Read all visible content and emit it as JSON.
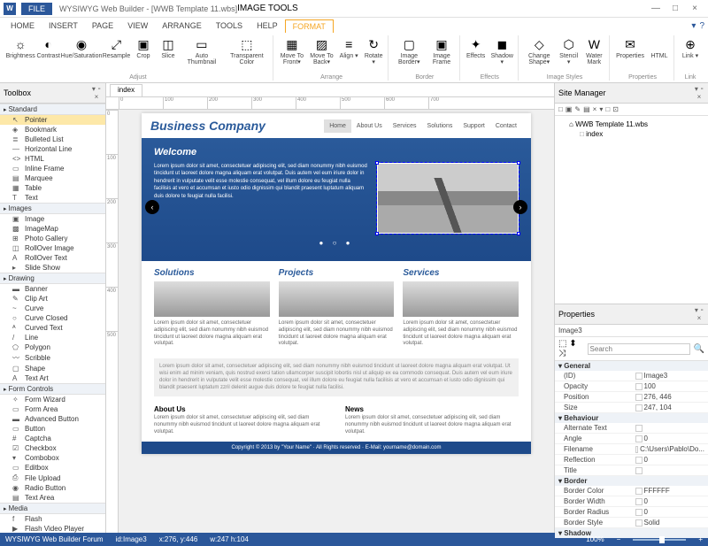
{
  "app": {
    "icon_label": "W",
    "file_label": "FILE",
    "title": "WYSIWYG Web Builder - [WWB Template 11.wbs]",
    "context_tool": "IMAGE TOOLS",
    "win_min": "—",
    "win_max": "□",
    "win_close": "×"
  },
  "menu": {
    "tabs": [
      "HOME",
      "INSERT",
      "PAGE",
      "VIEW",
      "ARRANGE",
      "TOOLS",
      "HELP",
      "FORMAT"
    ],
    "active": "FORMAT",
    "help_icon": "?",
    "down_icon": "▾"
  },
  "ribbon": {
    "groups": [
      {
        "label": "Adjust",
        "items": [
          {
            "icon": "☼",
            "label": "Brightness"
          },
          {
            "icon": "◐",
            "label": "Contrast"
          },
          {
            "icon": "◉",
            "label": "Hue/Saturation"
          },
          {
            "icon": "⤢",
            "label": "Resample"
          },
          {
            "icon": "▣",
            "label": "Crop"
          },
          {
            "icon": "◫",
            "label": "Slice"
          },
          {
            "icon": "▭",
            "label": "Auto Thumbnail"
          },
          {
            "icon": "⬚",
            "label": "Transparent Color"
          }
        ]
      },
      {
        "label": "Arrange",
        "items": [
          {
            "icon": "▦",
            "label": "Move To Front▾"
          },
          {
            "icon": "▨",
            "label": "Move To Back▾"
          },
          {
            "icon": "≡",
            "label": "Align ▾"
          },
          {
            "icon": "↻",
            "label": "Rotate ▾"
          }
        ]
      },
      {
        "label": "Border",
        "items": [
          {
            "icon": "▢",
            "label": "Image Border▾"
          },
          {
            "icon": "▣",
            "label": "Image Frame"
          }
        ]
      },
      {
        "label": "Effects",
        "items": [
          {
            "icon": "✦",
            "label": "Effects"
          },
          {
            "icon": "◼",
            "label": "Shadow ▾"
          }
        ]
      },
      {
        "label": "Image Styles",
        "items": [
          {
            "icon": "◇",
            "label": "Change Shape▾"
          },
          {
            "icon": "⬡",
            "label": "Stencil ▾"
          },
          {
            "icon": "W",
            "label": "Water Mark"
          }
        ]
      },
      {
        "label": "Properties",
        "items": [
          {
            "icon": "✉",
            "label": "Properties"
          },
          {
            "icon": "</>",
            "label": "HTML"
          }
        ]
      },
      {
        "label": "Link",
        "items": [
          {
            "icon": "⊕",
            "label": "Link ▾"
          }
        ]
      }
    ]
  },
  "toolbox": {
    "title": "Toolbox",
    "pin": "▾ ⁃ ×",
    "categories": [
      {
        "name": "Standard",
        "items": [
          {
            "icon": "↖",
            "label": "Pointer",
            "sel": true
          },
          {
            "icon": "◈",
            "label": "Bookmark"
          },
          {
            "icon": "≣",
            "label": "Bulleted List"
          },
          {
            "icon": "—",
            "label": "Horizontal Line"
          },
          {
            "icon": "<>",
            "label": "HTML"
          },
          {
            "icon": "▭",
            "label": "Inline Frame"
          },
          {
            "icon": "▤",
            "label": "Marquee"
          },
          {
            "icon": "▦",
            "label": "Table"
          },
          {
            "icon": "T",
            "label": "Text"
          }
        ]
      },
      {
        "name": "Images",
        "items": [
          {
            "icon": "▣",
            "label": "Image"
          },
          {
            "icon": "▩",
            "label": "ImageMap"
          },
          {
            "icon": "⊞",
            "label": "Photo Gallery"
          },
          {
            "icon": "◫",
            "label": "RollOver Image"
          },
          {
            "icon": "A",
            "label": "RollOver Text"
          },
          {
            "icon": "▸",
            "label": "Slide Show"
          }
        ]
      },
      {
        "name": "Drawing",
        "items": [
          {
            "icon": "▬",
            "label": "Banner"
          },
          {
            "icon": "✎",
            "label": "Clip Art"
          },
          {
            "icon": "~",
            "label": "Curve"
          },
          {
            "icon": "○",
            "label": "Curve Closed"
          },
          {
            "icon": "ᴬ",
            "label": "Curved Text"
          },
          {
            "icon": "/",
            "label": "Line"
          },
          {
            "icon": "⬠",
            "label": "Polygon"
          },
          {
            "icon": "〰",
            "label": "Scribble"
          },
          {
            "icon": "▢",
            "label": "Shape"
          },
          {
            "icon": "A",
            "label": "Text Art"
          }
        ]
      },
      {
        "name": "Form Controls",
        "items": [
          {
            "icon": "✧",
            "label": "Form Wizard"
          },
          {
            "icon": "▭",
            "label": "Form Area"
          },
          {
            "icon": "▬",
            "label": "Advanced Button"
          },
          {
            "icon": "▭",
            "label": "Button"
          },
          {
            "icon": "#",
            "label": "Captcha"
          },
          {
            "icon": "☑",
            "label": "Checkbox"
          },
          {
            "icon": "▾",
            "label": "Combobox"
          },
          {
            "icon": "▭",
            "label": "Editbox"
          },
          {
            "icon": "⎙",
            "label": "File Upload"
          },
          {
            "icon": "◉",
            "label": "Radio Button"
          },
          {
            "icon": "▤",
            "label": "Text Area"
          }
        ]
      },
      {
        "name": "Media",
        "items": [
          {
            "icon": "f",
            "label": "Flash"
          },
          {
            "icon": "▶",
            "label": "Flash Video Player"
          }
        ]
      }
    ]
  },
  "doc": {
    "tab": "index",
    "ruler_marks": [
      "0",
      "100",
      "200",
      "300",
      "400",
      "500",
      "600",
      "700"
    ],
    "ruler_v": [
      "0",
      "100",
      "200",
      "300",
      "400",
      "500"
    ]
  },
  "page": {
    "logo": "Business Company",
    "nav": [
      "Home",
      "About Us",
      "Services",
      "Solutions",
      "Support",
      "Contact"
    ],
    "nav_current": "Home",
    "hero_title": "Welcome",
    "hero_text": "Lorem ipsum dolor sit amet, consectetuer adipiscing elit, sed diam nonummy nibh euismod tincidunt ut laoreet dolore magna aliquam erat volutpat. Duis autem vel eum iriure dolor in hendrerit in vulputate velit esse molestie consequat, vel illum dolore eu feugiat nulla facilisis at vero et accumsan et iusto odio dignissim qui blandit praesent luptatum aliquam duis dolore te feugiat nulla facilisi.",
    "arrow_l": "‹",
    "arrow_r": "›",
    "dots": "● ○ ●",
    "cols": [
      {
        "title": "Solutions",
        "text": "Lorem ipsum dolor sit amet, consectetuer adipiscing elit, sed diam nonummy nibh euismod tincidunt ut laoreet dolore magna aliquam erat volutpat."
      },
      {
        "title": "Projects",
        "text": "Lorem ipsum dolor sit amet, consectetuer adipiscing elit, sed diam nonummy nibh euismod tincidunt ut laoreet dolore magna aliquam erat volutpat."
      },
      {
        "title": "Services",
        "text": "Lorem ipsum dolor sit amet, consectetuer adipiscing elit, sed diam nonummy nibh euismod tincidunt ut laoreet dolore magna aliquam erat volutpat."
      }
    ],
    "greybox": "Lorem ipsum dolor sit amet, consectetuer adipiscing elit, sed diam nonummy nibh euismod tincidunt ut laoreet dolore magna aliquam erat volutpat. Ut wisi enim ad minim veniam, quis nostrud exerci tation ullamcorper suscipit lobortis nisl ut aliquip ex ea commodo consequat. Duis autem vel eum iriure dolor in hendrerit in vulputate velit esse molestie consequat, vel illum dolore eu feugiat nulla facilisis at vero et accumsan et iusto odio dignissim qui blandit praesent luptatum zzril delenit augue duis dolore te feugiat nulla facilisi.",
    "lower": [
      {
        "title": "About Us",
        "text": "Lorem ipsum dolor sit amet, consectetuer adipiscing elit, sed diam nonummy nibh euismod tincidunt ut laoreet dolore magna aliquam erat volutpat."
      },
      {
        "title": "News",
        "text": "Lorem ipsum dolor sit amet, consectetuer adipiscing elit, sed diam nonummy nibh euismod tincidunt ut laoreet dolore magna aliquam erat volutpat."
      }
    ],
    "footer": "Copyright © 2013 by \"Your Name\"  ·  All Rights reserved  ·  E-Mail: yourname@domain.com"
  },
  "site_mgr": {
    "title": "Site Manager",
    "toolbar": [
      "□",
      "▣",
      "✎",
      "▤",
      "×",
      "▾",
      "□",
      "⊡"
    ],
    "root": "WWB Template 11.wbs",
    "child": "index"
  },
  "props": {
    "title": "Properties",
    "object": "Image3",
    "search_ph": "Search",
    "sort_icons": "⬚ ⬍ ⤨",
    "cats": [
      {
        "name": "General",
        "rows": [
          {
            "k": "(ID)",
            "v": "Image3"
          },
          {
            "k": "Opacity",
            "v": "100"
          },
          {
            "k": "Position",
            "v": "276, 446"
          },
          {
            "k": "Size",
            "v": "247, 104"
          }
        ]
      },
      {
        "name": "Behaviour",
        "rows": [
          {
            "k": "Alternate Text",
            "v": ""
          },
          {
            "k": "Angle",
            "v": "0"
          },
          {
            "k": "Filename",
            "v": "C:\\Users\\Pablo\\Do..."
          },
          {
            "k": "Reflection",
            "v": "0"
          },
          {
            "k": "Title",
            "v": ""
          }
        ]
      },
      {
        "name": "Border",
        "rows": [
          {
            "k": "Border Color",
            "v": "FFFFFF",
            "swatch": "#ffffff"
          },
          {
            "k": "Border Width",
            "v": "0"
          },
          {
            "k": "Border Radius",
            "v": "0"
          },
          {
            "k": "Border Style",
            "v": "Solid"
          }
        ]
      },
      {
        "name": "Shadow",
        "rows": []
      }
    ]
  },
  "status": {
    "forum": "WYSIWYG Web Builder Forum",
    "id": "id:Image3",
    "xy": "x:276, y:446",
    "wh": "w:247 h:104",
    "zoom": "100%",
    "minus": "−",
    "plus": "+"
  }
}
